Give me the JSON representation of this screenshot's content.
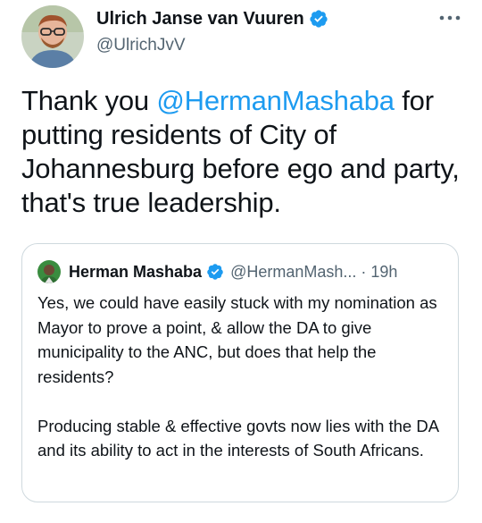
{
  "tweet": {
    "author": {
      "name": "Ulrich Janse van Vuuren",
      "handle": "@UlrichJvV",
      "verified": true,
      "avatar_icon": "avatar-photo"
    },
    "text_before": "Thank you ",
    "mention": "@HermanMashaba",
    "text_after": " for putting residents of City of Johannesburg before ego and party, that's true leadership.",
    "more_icon": "more-horizontal-icon"
  },
  "quoted_tweet": {
    "author": {
      "name": "Herman Mashaba",
      "handle": "@HermanMash...",
      "verified": true
    },
    "separator": "·",
    "time": "19h",
    "paragraph_1": "Yes, we could have easily stuck with my nomination as Mayor to prove a point, & allow the DA to give municipality to the ANC, but does that help the residents?",
    "paragraph_2": "Producing stable & effective govts now lies with the DA and its ability to act in the interests of South Africans."
  },
  "colors": {
    "accent": "#1d9bf0",
    "text": "#0f1419",
    "secondary": "#536471",
    "border": "#cfd9de"
  }
}
